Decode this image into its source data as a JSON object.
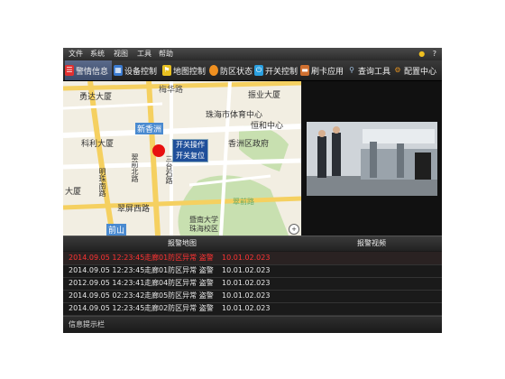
{
  "menu": [
    "文件",
    "系统",
    "视图",
    "工具",
    "帮助"
  ],
  "menu_icons": {
    "lock": "lock-icon",
    "help": "?"
  },
  "toolbar": [
    {
      "label": "警情信息",
      "icon": "alarm-list-icon",
      "color": "#e03030"
    },
    {
      "label": "设备控制",
      "icon": "device-icon",
      "color": "#3a7ad0"
    },
    {
      "label": "地图控制",
      "icon": "map-icon",
      "color": "#e8c020"
    },
    {
      "label": "防区状态",
      "icon": "bulb-icon",
      "color": "#f09020"
    },
    {
      "label": "开关控制",
      "icon": "power-icon",
      "color": "#2aa0e0"
    },
    {
      "label": "刷卡应用",
      "icon": "card-icon",
      "color": "#d07030"
    },
    {
      "label": "查询工具",
      "icon": "search-icon",
      "color": "#a0c0e0"
    },
    {
      "label": "配置中心",
      "icon": "gear-icon",
      "color": "#e09020"
    }
  ],
  "map": {
    "labels": [
      "勇达大厦",
      "梅华路",
      "振业大厦",
      "恒和中心",
      "珠海市体育中心",
      "新香洲",
      "科利大厦",
      "香洲区政府",
      "三台石路",
      "翠前北路",
      "明珠南路",
      "大厦",
      "翠屏西路",
      "暨南大学",
      "珠海校区",
      "前山",
      "翠前路"
    ],
    "popup": [
      "开关操作",
      "开关复位"
    ],
    "marker_color": "#e81010"
  },
  "panels": {
    "map_title": "报警地图",
    "video_title": "报警视频"
  },
  "alarms": [
    {
      "time": "2014.09.05 12:23:45",
      "desc": "走廊01防区异常  盗警",
      "ip": "10.01.02.023",
      "alert": true
    },
    {
      "time": "2014.09.05 12:23:45",
      "desc": "走廊01防区异常  盗警",
      "ip": "10.01.02.023",
      "alert": false
    },
    {
      "time": "2012.09.05 14:23:41",
      "desc": "走廊04防区异常  盗警",
      "ip": "10.01.02.023",
      "alert": false
    },
    {
      "time": "2014.09.05 02:23:42",
      "desc": "走廊05防区异常  盗警",
      "ip": "10.01.02.023",
      "alert": false
    },
    {
      "time": "2014.09.05 12:23:45",
      "desc": "走廊02防区异常  盗警",
      "ip": "10.01.02.023",
      "alert": false
    }
  ],
  "status": "信息提示栏"
}
